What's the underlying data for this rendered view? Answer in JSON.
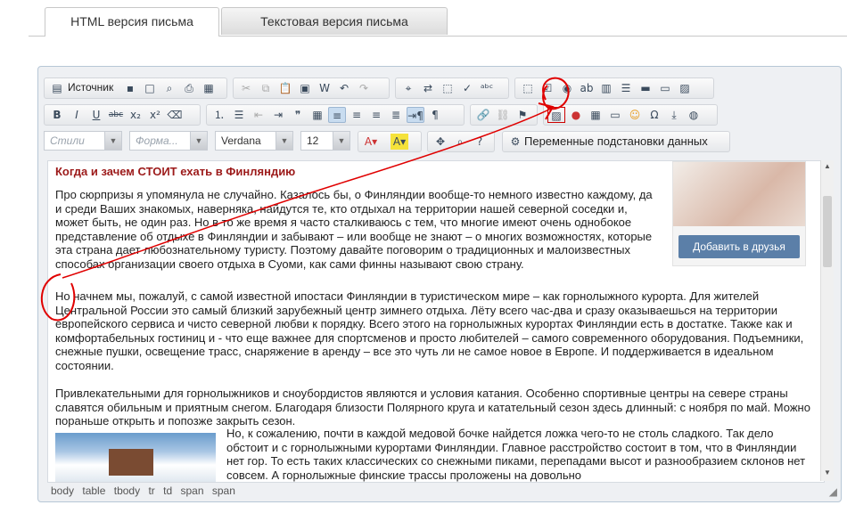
{
  "tabs": {
    "html": "HTML версия письма",
    "text": "Текстовая версия письма"
  },
  "toolbar": {
    "source_label": "Источник",
    "style_placeholder": "Стили",
    "format_placeholder": "Форма...",
    "font_value": "Verdana",
    "size_value": "12",
    "variables_label": "Переменные подстановки данных"
  },
  "content": {
    "heading": "Когда и зачем СТОИТ ехать в Финляндию",
    "p1": "Про сюрпризы я упомянула не случайно. Казалось бы, о Финляндии вообще-то немного известно каждому, да и среди Ваших знакомых, наверняка, найдутся те, кто отдыхал на территории нашей северной соседки и, может быть, не один раз. Но в то же время я часто сталкиваюсь с тем, что многие имеют очень однобокое представление об отдыхе в Финляндии и забывают – или вообще не знают – о многих возможностях, которые эта страна дает любознательному туристу. Поэтому давайте поговорим о традиционных и малоизвестных способах организации своего отдыха в Суоми, как сами финны называют свою страну.",
    "p2": "Но начнем мы, пожалуй, с самой известной ипостаси Финляндии в туристическом мире – как горнолыжного курорта. Для жителей Центральной России это самый близкий зарубежный центр зимнего отдыха. Лёту всего час-два и сразу оказываешься на территории европейского сервиса и чисто северной любви к порядку. Всего этого на горнолыжных курортах Финляндии есть в достатке. Также как и комфортабельных гостиниц и - что еще важнее для спортсменов и просто любителей – самого современного оборудования. Подъемники, снежные пушки, освещение трасс, снаряжение в аренду – все это чуть ли не самое новое в Европе. И поддерживается в идеальном состоянии.",
    "p3": "Привлекательными для горнолыжников и сноубордистов являются и условия катания. Особенно спортивные центры на севере страны славятся обильным и приятным снегом. Благодаря близости Полярного круга и катательный сезон здесь длинный: с ноября по май. Можно пораньше открыть и попозже закрыть сезон.",
    "p4": "Но, к сожалению, почти в каждой медовой бочке найдется ложка чего-то не столь сладкого. Так дело обстоит и с горнолыжными курортами Финляндии. Главное расстройство состоит в том, что в Финляндии нет гор. То есть таких классических со снежными пиками, перепадами высот и разнообразием склонов нет совсем. А горнолыжные финские трассы проложены на довольно",
    "add_friend": "Добавить в друзья"
  },
  "statusbar": {
    "path": [
      "body",
      "table",
      "tbody",
      "tr",
      "td",
      "span",
      "span"
    ]
  }
}
